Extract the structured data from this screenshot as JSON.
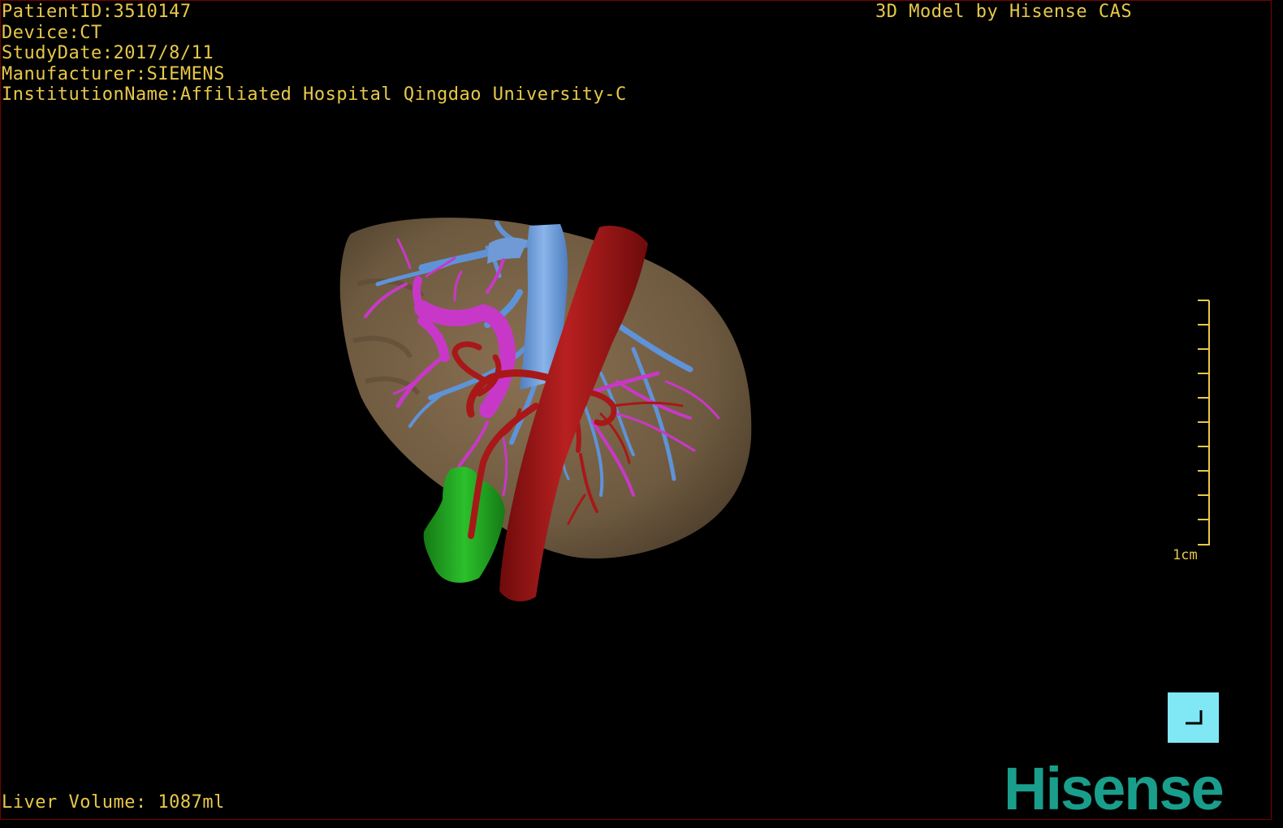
{
  "overlay": {
    "patient_id": "PatientID:3510147",
    "device": "Device:CT",
    "study_date": "StudyDate:2017/8/11",
    "manufacturer": "Manufacturer:SIEMENS",
    "institution": "InstitutionName:Affiliated Hospital Qingdao University-C",
    "credit": "3D Model by Hisense CAS",
    "liver_volume": "Liver Volume: 1087ml"
  },
  "scale_bar": {
    "label": "1cm"
  },
  "logo": {
    "text": "Hisense"
  },
  "icons": {
    "view_reset": "corner-bracket-icon"
  },
  "colors": {
    "overlay_text": "#e7c84a",
    "liver": "#7a6448",
    "portal_vein": "#c838c8",
    "hepatic_vein": "#5f93d8",
    "ivc": "#6f9ad6",
    "artery": "#a81818",
    "gallbladder": "#1fa01f",
    "button": "#7fe8f4",
    "logo": "#1a9e8c"
  }
}
